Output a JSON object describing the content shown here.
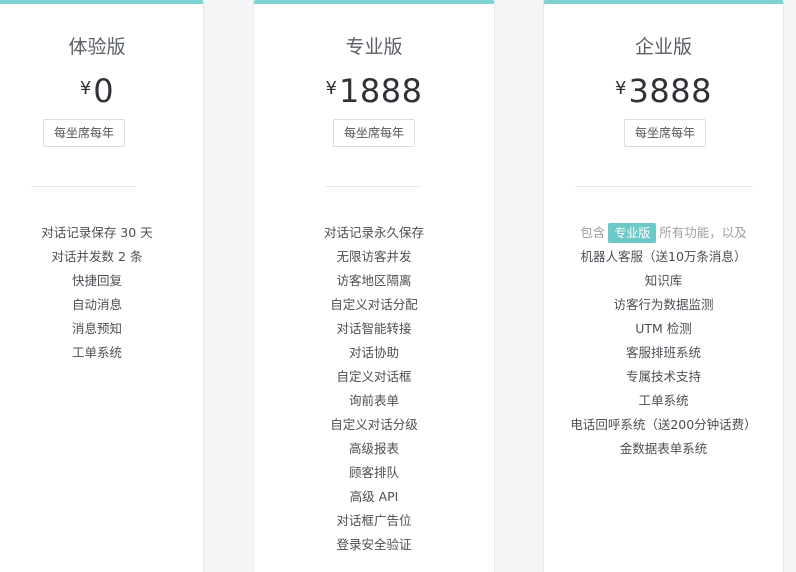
{
  "plans": {
    "basic": {
      "name": "体验版",
      "currency": "¥",
      "price": "0",
      "unit": "每坐席每年",
      "features": [
        "对话记录保存 30 天",
        "对话并发数 2 条",
        "快捷回复",
        "自动消息",
        "消息预知",
        "工单系统"
      ]
    },
    "pro": {
      "name": "专业版",
      "currency": "¥",
      "price": "1888",
      "unit": "每坐席每年",
      "features": [
        "对话记录永久保存",
        "无限访客并发",
        "访客地区隔离",
        "自定义对话分配",
        "对话智能转接",
        "对话协助",
        "自定义对话框",
        "询前表单",
        "自定义对话分级",
        "高级报表",
        "顾客排队",
        "高级 API",
        "对话框广告位",
        "登录安全验证"
      ]
    },
    "enterprise": {
      "name": "企业版",
      "currency": "¥",
      "price": "3888",
      "unit": "每坐席每年",
      "intro_prefix": "包含",
      "intro_tag": "专业版",
      "intro_suffix": "所有功能，以及",
      "features": [
        "机器人客服（送10万条消息）",
        "知识库",
        "访客行为数据监测",
        "UTM 检测",
        "客服排班系统",
        "专属技术支持",
        "工单系统",
        "电话回呼系统（送200分钟话费）",
        "金数据表单系统"
      ]
    }
  },
  "colors": {
    "accent": "#6cc9c8",
    "top_border": "#7ed3d2"
  }
}
